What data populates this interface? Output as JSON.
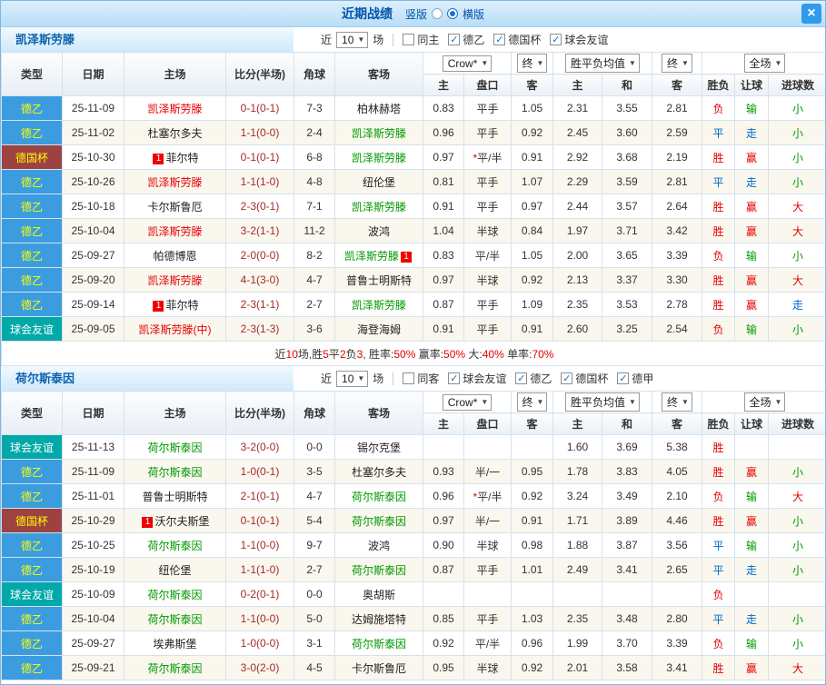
{
  "titlebar": {
    "title": "近期战绩",
    "vertical_label": "竖版",
    "horizontal_label": "横版",
    "selected_layout": "横版",
    "close": "×"
  },
  "filters_common": {
    "prefix": "近",
    "rounds": "10",
    "suffix": "场"
  },
  "header": {
    "col_labels": [
      "类型",
      "日期",
      "主场",
      "比分(半场)",
      "角球",
      "客场"
    ],
    "sub_labels": [
      "主",
      "盘口",
      "客",
      "主",
      "和",
      "客",
      "胜负",
      "让球",
      "进球数"
    ],
    "odds_source": "Crow*",
    "final_label": "终",
    "avg_label": "胜平负均值",
    "scope_label": "全场"
  },
  "type_colors": {
    "德乙": {
      "bg": "#3b9de0",
      "fg": "#ffff00"
    },
    "德国杯": {
      "bg": "#9e4141",
      "fg": "#ffff00"
    },
    "球会友谊": {
      "bg": "#00a8a8",
      "fg": "#ffffff"
    }
  },
  "team_name_colors": {
    "red": "#e60000",
    "green": "#009900",
    "black": "#222222"
  },
  "result_colors": {
    "胜": "#e60000",
    "平": "#0066cc",
    "负": "#e60000",
    "赢": "#e60000",
    "走": "#0066cc",
    "输": "#009900",
    "大": "#e60000",
    "小": "#009900"
  },
  "score_color": "#a52a2a",
  "teams": [
    {
      "name": "凯泽斯劳滕",
      "filters": [
        {
          "label": "同主",
          "checked": false
        },
        {
          "label": "德乙",
          "checked": true
        },
        {
          "label": "德国杯",
          "checked": true
        },
        {
          "label": "球会友谊",
          "checked": true
        }
      ],
      "rows": [
        {
          "type": "德乙",
          "date": "25-11-09",
          "home": {
            "text": "凯泽斯劳滕",
            "color": "red"
          },
          "score": "0-1(0-1)",
          "corner": "7-3",
          "away": {
            "text": "柏林赫塔",
            "color": "black"
          },
          "odds": [
            "0.83",
            "平手",
            "1.05"
          ],
          "avg": [
            "2.31",
            "3.55",
            "2.81"
          ],
          "results": [
            "负",
            "输",
            "小"
          ]
        },
        {
          "type": "德乙",
          "date": "25-11-02",
          "home": {
            "text": "杜塞尔多夫",
            "color": "black"
          },
          "score": "1-1(0-0)",
          "corner": "2-4",
          "away": {
            "text": "凯泽斯劳滕",
            "color": "green"
          },
          "odds": [
            "0.96",
            "平手",
            "0.92"
          ],
          "avg": [
            "2.45",
            "3.60",
            "2.59"
          ],
          "results": [
            "平",
            "走",
            "小"
          ]
        },
        {
          "type": "德国杯",
          "date": "25-10-30",
          "home": {
            "text": "菲尔特",
            "color": "black",
            "badge": "1"
          },
          "score": "0-1(0-1)",
          "corner": "6-8",
          "away": {
            "text": "凯泽斯劳滕",
            "color": "green"
          },
          "odds": [
            "0.97",
            "*平/半",
            "0.91"
          ],
          "avg": [
            "2.92",
            "3.68",
            "2.19"
          ],
          "results": [
            "胜",
            "赢",
            "小"
          ]
        },
        {
          "type": "德乙",
          "date": "25-10-26",
          "home": {
            "text": "凯泽斯劳滕",
            "color": "red"
          },
          "score": "1-1(1-0)",
          "corner": "4-8",
          "away": {
            "text": "纽伦堡",
            "color": "black"
          },
          "odds": [
            "0.81",
            "平手",
            "1.07"
          ],
          "avg": [
            "2.29",
            "3.59",
            "2.81"
          ],
          "results": [
            "平",
            "走",
            "小"
          ]
        },
        {
          "type": "德乙",
          "date": "25-10-18",
          "home": {
            "text": "卡尔斯鲁厄",
            "color": "black"
          },
          "score": "2-3(0-1)",
          "corner": "7-1",
          "away": {
            "text": "凯泽斯劳滕",
            "color": "green"
          },
          "odds": [
            "0.91",
            "平手",
            "0.97"
          ],
          "avg": [
            "2.44",
            "3.57",
            "2.64"
          ],
          "results": [
            "胜",
            "赢",
            "大"
          ]
        },
        {
          "type": "德乙",
          "date": "25-10-04",
          "home": {
            "text": "凯泽斯劳滕",
            "color": "red"
          },
          "score": "3-2(1-1)",
          "corner": "11-2",
          "away": {
            "text": "波鸿",
            "color": "black"
          },
          "odds": [
            "1.04",
            "半球",
            "0.84"
          ],
          "avg": [
            "1.97",
            "3.71",
            "3.42"
          ],
          "results": [
            "胜",
            "赢",
            "大"
          ]
        },
        {
          "type": "德乙",
          "date": "25-09-27",
          "home": {
            "text": "帕德博恩",
            "color": "black"
          },
          "score": "2-0(0-0)",
          "corner": "8-2",
          "away": {
            "text": "凯泽斯劳滕",
            "color": "green",
            "badge": "1"
          },
          "odds": [
            "0.83",
            "平/半",
            "1.05"
          ],
          "avg": [
            "2.00",
            "3.65",
            "3.39"
          ],
          "results": [
            "负",
            "输",
            "小"
          ]
        },
        {
          "type": "德乙",
          "date": "25-09-20",
          "home": {
            "text": "凯泽斯劳滕",
            "color": "red"
          },
          "score": "4-1(3-0)",
          "corner": "4-7",
          "away": {
            "text": "普鲁士明斯特",
            "color": "black"
          },
          "odds": [
            "0.97",
            "半球",
            "0.92"
          ],
          "avg": [
            "2.13",
            "3.37",
            "3.30"
          ],
          "results": [
            "胜",
            "赢",
            "大"
          ]
        },
        {
          "type": "德乙",
          "date": "25-09-14",
          "home": {
            "text": "菲尔特",
            "color": "black",
            "badge": "1"
          },
          "score": "2-3(1-1)",
          "corner": "2-7",
          "away": {
            "text": "凯泽斯劳滕",
            "color": "green"
          },
          "odds": [
            "0.87",
            "平手",
            "1.09"
          ],
          "avg": [
            "2.35",
            "3.53",
            "2.78"
          ],
          "results": [
            "胜",
            "赢",
            "走"
          ]
        },
        {
          "type": "球会友谊",
          "date": "25-09-05",
          "home": {
            "text": "凯泽斯劳滕(中)",
            "color": "red"
          },
          "score": "2-3(1-3)",
          "corner": "3-6",
          "away": {
            "text": "海登海姆",
            "color": "black"
          },
          "odds": [
            "0.91",
            "平手",
            "0.91"
          ],
          "avg": [
            "2.60",
            "3.25",
            "2.54"
          ],
          "results": [
            "负",
            "输",
            "小"
          ]
        }
      ],
      "summary": [
        {
          "text": "近",
          "red": false
        },
        {
          "text": "10",
          "red": true
        },
        {
          "text": "场,胜",
          "red": false
        },
        {
          "text": "5",
          "red": true
        },
        {
          "text": "平",
          "red": false
        },
        {
          "text": "2",
          "red": true
        },
        {
          "text": "负",
          "red": false
        },
        {
          "text": "3",
          "red": true
        },
        {
          "text": ", 胜率:",
          "red": false
        },
        {
          "text": "50%",
          "red": true
        },
        {
          "text": " 赢率:",
          "red": false
        },
        {
          "text": "50%",
          "red": true
        },
        {
          "text": " 大:",
          "red": false
        },
        {
          "text": "40%",
          "red": true
        },
        {
          "text": " 单率:",
          "red": false
        },
        {
          "text": "70%",
          "red": true
        }
      ]
    },
    {
      "name": "荷尔斯泰因",
      "filters": [
        {
          "label": "同客",
          "checked": false
        },
        {
          "label": "球会友谊",
          "checked": true
        },
        {
          "label": "德乙",
          "checked": true
        },
        {
          "label": "德国杯",
          "checked": true
        },
        {
          "label": "德甲",
          "checked": true
        }
      ],
      "rows": [
        {
          "type": "球会友谊",
          "date": "25-11-13",
          "home": {
            "text": "荷尔斯泰因",
            "color": "green"
          },
          "score": "3-2(0-0)",
          "corner": "0-0",
          "away": {
            "text": "锡尔克堡",
            "color": "black"
          },
          "odds": [
            "",
            "",
            ""
          ],
          "avg": [
            "1.60",
            "3.69",
            "5.38"
          ],
          "results": [
            "胜",
            "",
            ""
          ]
        },
        {
          "type": "德乙",
          "date": "25-11-09",
          "home": {
            "text": "荷尔斯泰因",
            "color": "green"
          },
          "score": "1-0(0-1)",
          "corner": "3-5",
          "away": {
            "text": "杜塞尔多夫",
            "color": "black"
          },
          "odds": [
            "0.93",
            "半/一",
            "0.95"
          ],
          "avg": [
            "1.78",
            "3.83",
            "4.05"
          ],
          "results": [
            "胜",
            "赢",
            "小"
          ]
        },
        {
          "type": "德乙",
          "date": "25-11-01",
          "home": {
            "text": "普鲁士明斯特",
            "color": "black"
          },
          "score": "2-1(0-1)",
          "corner": "4-7",
          "away": {
            "text": "荷尔斯泰因",
            "color": "green"
          },
          "odds": [
            "0.96",
            "*平/半",
            "0.92"
          ],
          "avg": [
            "3.24",
            "3.49",
            "2.10"
          ],
          "results": [
            "负",
            "输",
            "大"
          ]
        },
        {
          "type": "德国杯",
          "date": "25-10-29",
          "home": {
            "text": "沃尔夫斯堡",
            "color": "black",
            "badge": "1"
          },
          "score": "0-1(0-1)",
          "corner": "5-4",
          "away": {
            "text": "荷尔斯泰因",
            "color": "green"
          },
          "odds": [
            "0.97",
            "半/一",
            "0.91"
          ],
          "avg": [
            "1.71",
            "3.89",
            "4.46"
          ],
          "results": [
            "胜",
            "赢",
            "小"
          ]
        },
        {
          "type": "德乙",
          "date": "25-10-25",
          "home": {
            "text": "荷尔斯泰因",
            "color": "green"
          },
          "score": "1-1(0-0)",
          "corner": "9-7",
          "away": {
            "text": "波鸿",
            "color": "black"
          },
          "odds": [
            "0.90",
            "半球",
            "0.98"
          ],
          "avg": [
            "1.88",
            "3.87",
            "3.56"
          ],
          "results": [
            "平",
            "输",
            "小"
          ]
        },
        {
          "type": "德乙",
          "date": "25-10-19",
          "home": {
            "text": "纽伦堡",
            "color": "black"
          },
          "score": "1-1(1-0)",
          "corner": "2-7",
          "away": {
            "text": "荷尔斯泰因",
            "color": "green"
          },
          "odds": [
            "0.87",
            "平手",
            "1.01"
          ],
          "avg": [
            "2.49",
            "3.41",
            "2.65"
          ],
          "results": [
            "平",
            "走",
            "小"
          ]
        },
        {
          "type": "球会友谊",
          "date": "25-10-09",
          "home": {
            "text": "荷尔斯泰因",
            "color": "green"
          },
          "score": "0-2(0-1)",
          "corner": "0-0",
          "away": {
            "text": "奥胡斯",
            "color": "black"
          },
          "odds": [
            "",
            "",
            ""
          ],
          "avg": [
            "",
            "",
            ""
          ],
          "results": [
            "负",
            "",
            ""
          ]
        },
        {
          "type": "德乙",
          "date": "25-10-04",
          "home": {
            "text": "荷尔斯泰因",
            "color": "green"
          },
          "score": "1-1(0-0)",
          "corner": "5-0",
          "away": {
            "text": "达姆施塔特",
            "color": "black"
          },
          "odds": [
            "0.85",
            "平手",
            "1.03"
          ],
          "avg": [
            "2.35",
            "3.48",
            "2.80"
          ],
          "results": [
            "平",
            "走",
            "小"
          ]
        },
        {
          "type": "德乙",
          "date": "25-09-27",
          "home": {
            "text": "埃弗斯堡",
            "color": "black"
          },
          "score": "1-0(0-0)",
          "corner": "3-1",
          "away": {
            "text": "荷尔斯泰因",
            "color": "green"
          },
          "odds": [
            "0.92",
            "平/半",
            "0.96"
          ],
          "avg": [
            "1.99",
            "3.70",
            "3.39"
          ],
          "results": [
            "负",
            "输",
            "小"
          ]
        },
        {
          "type": "德乙",
          "date": "25-09-21",
          "home": {
            "text": "荷尔斯泰因",
            "color": "green"
          },
          "score": "3-0(2-0)",
          "corner": "4-5",
          "away": {
            "text": "卡尔斯鲁厄",
            "color": "black"
          },
          "odds": [
            "0.95",
            "半球",
            "0.92"
          ],
          "avg": [
            "2.01",
            "3.58",
            "3.41"
          ],
          "results": [
            "胜",
            "赢",
            "大"
          ]
        }
      ],
      "summary": null
    }
  ]
}
